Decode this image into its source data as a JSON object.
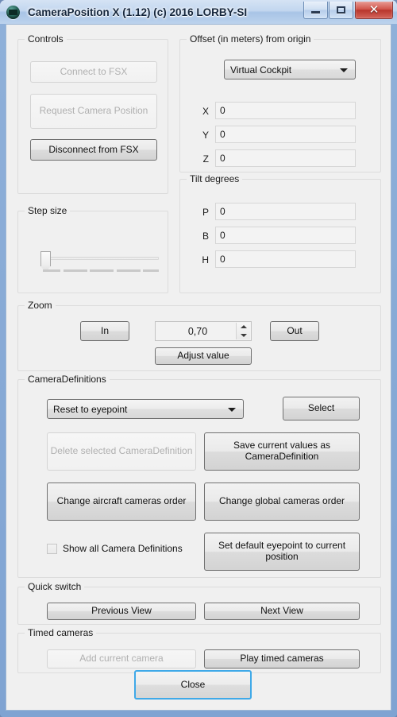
{
  "window": {
    "title": "CameraPosition X (1.12) (c) 2016 LORBY-SI",
    "icon": "camera-app-icon",
    "buttons": {
      "minimize": "minimize-icon",
      "maximize": "restore-icon",
      "close": "✕"
    }
  },
  "controls": {
    "legend": "Controls",
    "connect": "Connect to FSX",
    "request": "Request Camera Position",
    "disconnect": "Disconnect from FSX"
  },
  "step_size": {
    "legend": "Step size",
    "value_position": "0"
  },
  "offset": {
    "legend": "Offset (in meters) from origin",
    "mode": "Virtual Cockpit",
    "fields": [
      {
        "label": "X",
        "value": "0"
      },
      {
        "label": "Y",
        "value": "0"
      },
      {
        "label": "Z",
        "value": "0"
      }
    ]
  },
  "tilt": {
    "legend": "Tilt degrees",
    "fields": [
      {
        "label": "P",
        "value": "0"
      },
      {
        "label": "B",
        "value": "0"
      },
      {
        "label": "H",
        "value": "0"
      }
    ]
  },
  "zoom": {
    "legend": "Zoom",
    "in": "In",
    "out": "Out",
    "value": "0,70",
    "adjust": "Adjust value"
  },
  "camera_definitions": {
    "legend": "CameraDefinitions",
    "selected": "Reset to eyepoint",
    "select": "Select",
    "delete": "Delete selected CameraDefinition",
    "save": "Save current values as CameraDefinition",
    "change_aircraft_order": "Change aircraft cameras order",
    "change_global_order": "Change global cameras order",
    "show_all_label": "Show all Camera Definitions",
    "show_all_checked": false,
    "set_default_eyepoint": "Set default eyepoint to current position"
  },
  "quick_switch": {
    "legend": "Quick switch",
    "previous": "Previous View",
    "next": "Next View"
  },
  "timed_cameras": {
    "legend": "Timed cameras",
    "add": "Add current camera",
    "play": "Play timed cameras"
  },
  "footer": {
    "close": "Close"
  },
  "colors": {
    "dialog_bg": "#f0f0f0",
    "frame_blue": "#7fa3d2",
    "default_button_border": "#3fa9e8",
    "close_button_red": "#b8352c"
  }
}
